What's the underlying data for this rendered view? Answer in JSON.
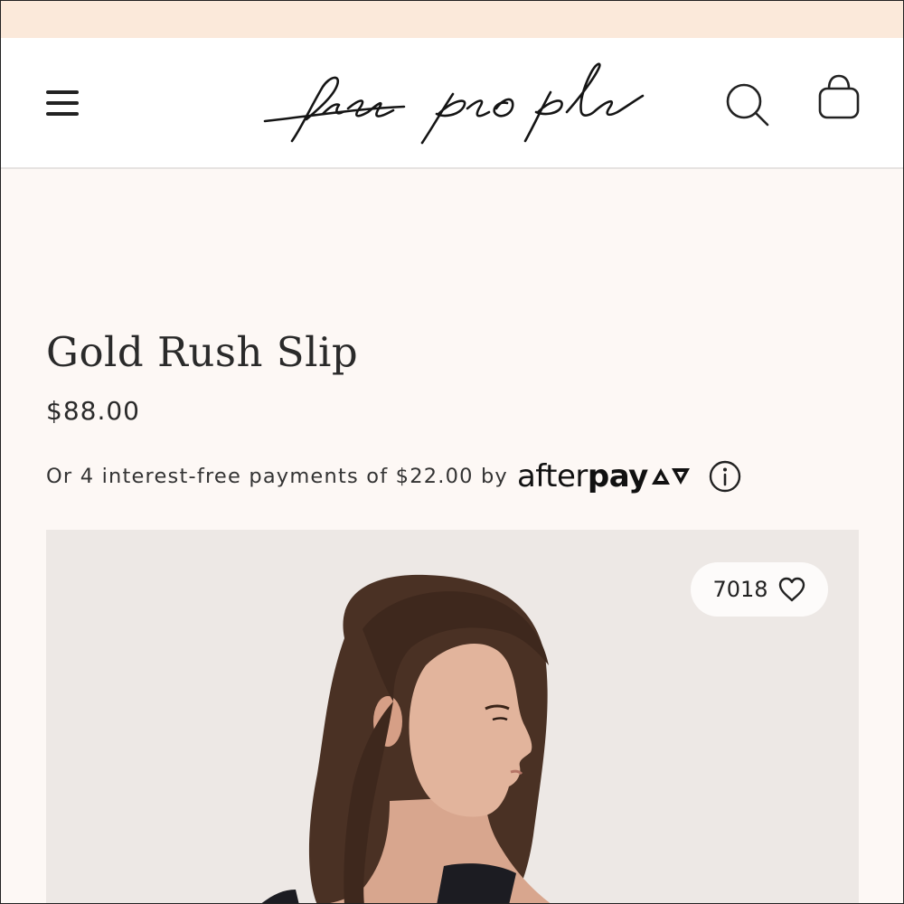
{
  "header": {
    "logo_text": "free people"
  },
  "product": {
    "title": "Gold Rush Slip",
    "price": "$88.00",
    "installments_text": "Or 4 interest-free payments of $22.00 by",
    "afterpay_light": "after",
    "afterpay_bold": "pay",
    "like_count": "7018"
  },
  "icons": {
    "menu": "hamburger-menu-icon",
    "search": "search-icon",
    "bag": "shopping-bag-icon",
    "info": "info-circle-icon",
    "heart": "heart-outline-icon",
    "afterpay": "afterpay-arrows-icon"
  },
  "colors": {
    "promo_banner": "#fbe9da",
    "page_background": "#fdf8f5",
    "header_background": "#ffffff",
    "image_background": "#ede8e5",
    "text": "#2a2a2a"
  }
}
